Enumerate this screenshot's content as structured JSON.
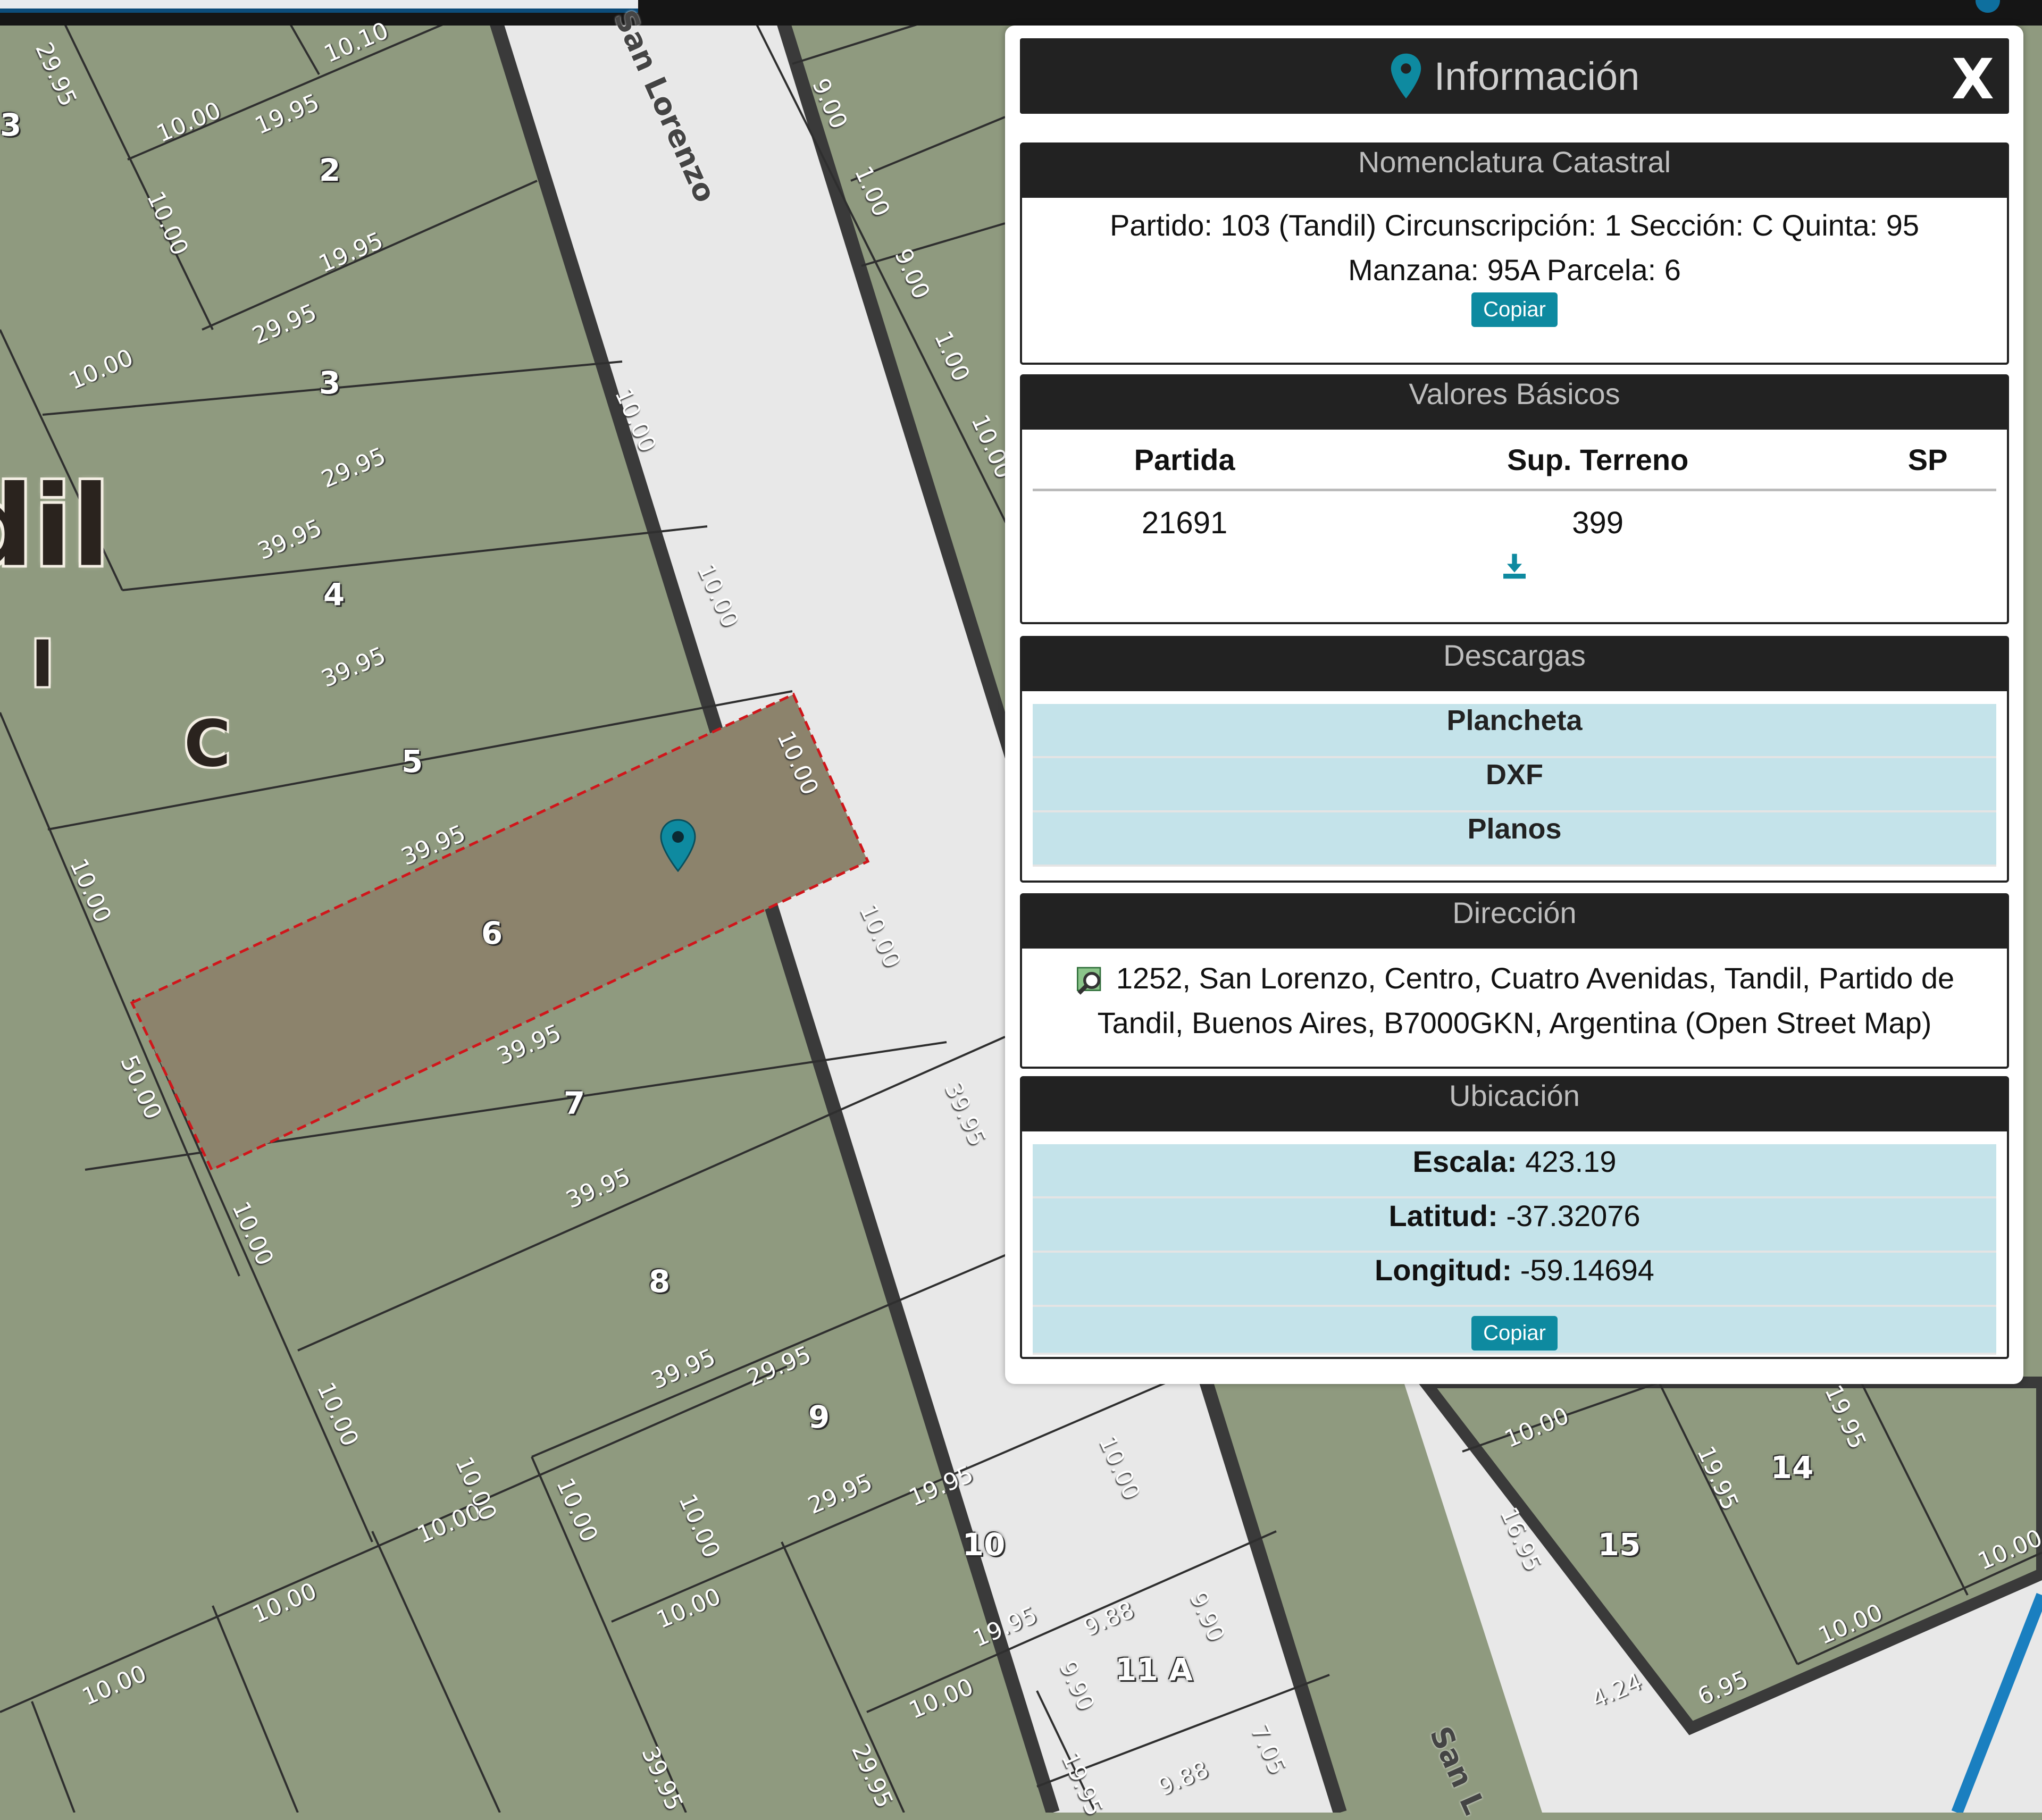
{
  "map": {
    "street_main": "San Lorenzo",
    "street_bottom": "San L",
    "lots": [
      "2",
      "3",
      "4",
      "5",
      "6",
      "7",
      "8",
      "9",
      "10",
      "11 A",
      "14",
      "15"
    ],
    "lot_3_cut": "3",
    "big_label": "dil",
    "mid_label_I": "I",
    "mid_label_C": "C",
    "dims": [
      "29.95",
      "10.10",
      "10.00",
      "19.95",
      "10.00",
      "19.95",
      "29.95",
      "10.00",
      "29.95",
      "39.95",
      "39.95",
      "10.00",
      "39.95",
      "10.00",
      "39.95",
      "10.00",
      "50.00",
      "10.00",
      "39.95",
      "10.00",
      "39.95",
      "10.00",
      "39.95",
      "29.95",
      "29.95",
      "19.95",
      "10.00",
      "10.00",
      "10.00",
      "10.00",
      "10.00",
      "10.00",
      "19.95",
      "9.88",
      "9.90",
      "9.90",
      "10.00",
      "7.05",
      "9.88",
      "19.95",
      "29.95",
      "39.95",
      "10.00",
      "9.00",
      "1.00",
      "9.00",
      "1.00",
      "10.00",
      "19.95",
      "19.95",
      "16.95",
      "10.00",
      "4.24",
      "6.95",
      "10.00",
      "10.00",
      "10.00",
      "10.00"
    ]
  },
  "panel": {
    "title": "Información",
    "close": "X",
    "nomenclatura": {
      "title": "Nomenclatura Catastral",
      "line1": "Partido: 103 (Tandil) Circunscripción: 1 Sección: C Quinta: 95",
      "line2": "Manzana: 95A Parcela: 6",
      "copy": "Copiar"
    },
    "valores": {
      "title": "Valores Básicos",
      "headers": [
        "Partida",
        "Sup. Terreno",
        "SP"
      ],
      "row": [
        "21691",
        "399",
        ""
      ],
      "download_icon": "download-icon"
    },
    "descargas": {
      "title": "Descargas",
      "items": [
        "Plancheta",
        "DXF",
        "Planos"
      ]
    },
    "direccion": {
      "title": "Dirección",
      "text": "1252, San Lorenzo, Centro, Cuatro Avenidas, Tandil, Partido de Tandil, Buenos Aires, B7000GKN, Argentina (Open Street Map)",
      "icon": "map-search-icon"
    },
    "ubicacion": {
      "title": "Ubicación",
      "escala_label": "Escala:",
      "escala": "423.19",
      "latitud_label": "Latitud:",
      "latitud": "-37.32076",
      "longitud_label": "Longitud:",
      "longitud": "-59.14694",
      "copy": "Copiar"
    }
  },
  "colors": {
    "parcel": "#8f9a7f",
    "street": "#e8e8e8",
    "border": "#3a3a3a",
    "selected_fill": "#8c836c",
    "selected_stroke": "#d0161b",
    "accent": "#0e8aa0"
  }
}
